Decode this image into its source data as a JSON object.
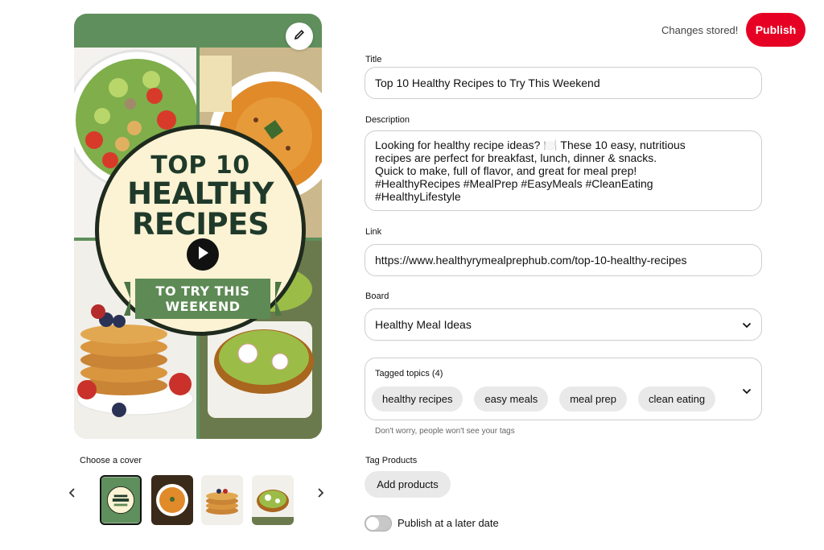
{
  "header": {
    "status_text": "Changes stored!",
    "publish_label": "Publish"
  },
  "preview": {
    "badge_top": "TOP 10",
    "badge_line1": "HEALTHY",
    "badge_line2": "RECIPES",
    "ribbon_line1": "TO TRY THIS",
    "ribbon_line2": "WEEKEND",
    "edit_icon": "pencil-icon",
    "play_icon": "play-icon"
  },
  "covers": {
    "label": "Choose a cover",
    "thumbs": [
      "cover-title",
      "cover-soup",
      "cover-pancakes",
      "cover-avocado-toast"
    ],
    "selected_index": 0
  },
  "form": {
    "title": {
      "label": "Title",
      "value": "Top 10 Healthy Recipes to Try This Weekend"
    },
    "description": {
      "label": "Description",
      "value": "Looking for healthy recipe ideas? 🍽️ These 10 easy, nutritious\nrecipes are perfect for breakfast, lunch, dinner & snacks.\nQuick to make, full of flavor, and great for meal prep!\n#HealthyRecipes #MealPrep #EasyMeals #CleanEating\n#HealthyLifestyle"
    },
    "link": {
      "label": "Link",
      "value": "https://www.healthyrymealprephub.com/top-10-healthy-recipes"
    },
    "board": {
      "label": "Board",
      "value": "Healthy Meal Ideas"
    },
    "tagged_topics": {
      "label": "Tagged topics (4)",
      "tags": [
        "healthy recipes",
        "easy meals",
        "meal prep",
        "clean eating"
      ],
      "hint": "Don't worry, people won't see your tags"
    },
    "tag_products": {
      "label": "Tag Products",
      "button": "Add products"
    },
    "schedule": {
      "label": "Publish at a later date",
      "enabled": false
    }
  },
  "colors": {
    "accent": "#e60023",
    "preview_green": "#5f8f5c",
    "badge_cream": "#fbf3d4",
    "ribbon_green": "#5e8a55"
  }
}
